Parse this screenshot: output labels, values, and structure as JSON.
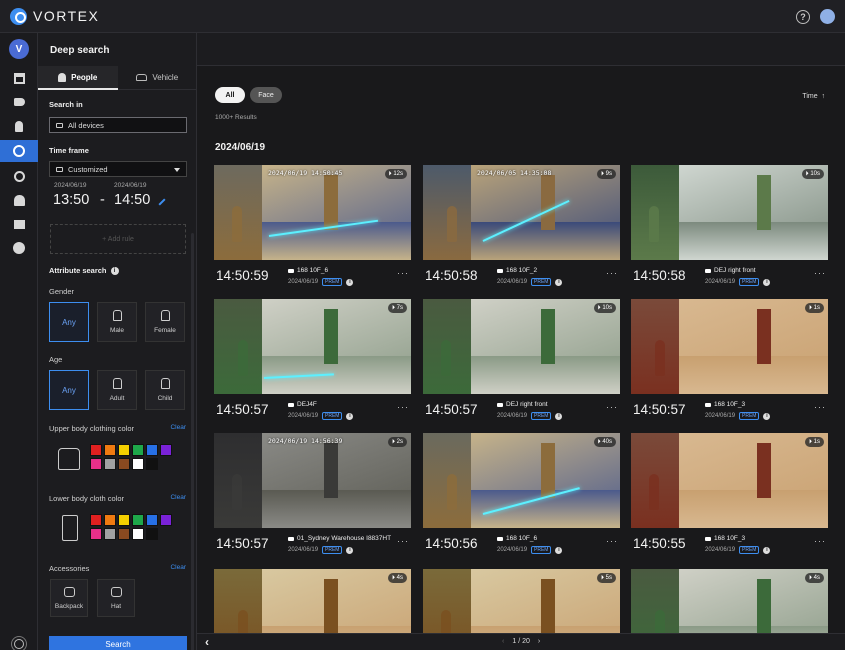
{
  "app": {
    "title": "VORTEX",
    "avatar_letter": "V",
    "accent": "#2f74e0"
  },
  "page_title": "Deep search",
  "tabs": [
    {
      "label": "People",
      "icon": "person-icon",
      "active": true
    },
    {
      "label": "Vehicle",
      "icon": "car-icon",
      "active": false
    }
  ],
  "search_in": {
    "label": "Search in",
    "value": "All devices"
  },
  "time_frame": {
    "label": "Time frame",
    "selected": "Customized",
    "start_date": "2024/06/19",
    "end_date": "2024/06/19",
    "start_time": "13:50",
    "separator": "-",
    "end_time": "14:50"
  },
  "add_rule": "+ Add rule",
  "attribute_search": {
    "label": "Attribute search",
    "gender": {
      "label": "Gender",
      "options": [
        "Any",
        "Male",
        "Female"
      ],
      "selected": "Any"
    },
    "age": {
      "label": "Age",
      "options": [
        "Any",
        "Adult",
        "Child"
      ],
      "selected": "Any"
    },
    "upper_color": {
      "label": "Upper body clothing color",
      "clear": "Clear"
    },
    "lower_color": {
      "label": "Lower body cloth color",
      "clear": "Clear"
    },
    "accessories": {
      "label": "Accessories",
      "clear": "Clear",
      "options": [
        "Backpack",
        "Hat"
      ]
    },
    "swatch_colors": [
      "#e02020",
      "#f07a10",
      "#f5d000",
      "#1ea84a",
      "#2770e6",
      "#7a22d8",
      "#e8308a",
      "#a0a0a0",
      "#8a4a20",
      "#ffffff",
      "#111111"
    ]
  },
  "search_button": "Search",
  "filters": {
    "chips": [
      "All",
      "Face"
    ],
    "sort_label": "Time",
    "sort_arrow": "↑"
  },
  "results_count": "1000+ Results",
  "group_date": "2024/06/19",
  "results": [
    {
      "time": "14:50:59",
      "camera": "168 10F_6",
      "date": "2024/06/19",
      "badge": "PREM",
      "overlay": "2024/06/19 14:50:45",
      "duration": "12s"
    },
    {
      "time": "14:50:58",
      "camera": "168 10F_2",
      "date": "2024/06/19",
      "badge": "PREM",
      "overlay": "2024/06/05 14:35:08",
      "duration": "9s"
    },
    {
      "time": "14:50:58",
      "camera": "DEJ right front",
      "date": "2024/06/19",
      "badge": "PREM",
      "overlay": "",
      "duration": "10s"
    },
    {
      "time": "14:50:57",
      "camera": "DEJ4F",
      "date": "2024/06/19",
      "badge": "PREM",
      "overlay": "",
      "duration": "7s"
    },
    {
      "time": "14:50:57",
      "camera": "DEJ right front",
      "date": "2024/06/19",
      "badge": "PREM",
      "overlay": "",
      "duration": "10s"
    },
    {
      "time": "14:50:57",
      "camera": "168 10F_3",
      "date": "2024/06/19",
      "badge": "PREM",
      "overlay": "",
      "duration": "1s"
    },
    {
      "time": "14:50:57",
      "camera": "01_Sydney Warehouse I8837HT",
      "date": "2024/06/19",
      "badge": "PREM",
      "overlay": "2024/06/19 14:56:39",
      "duration": "2s"
    },
    {
      "time": "14:50:56",
      "camera": "168 10F_6",
      "date": "2024/06/19",
      "badge": "PREM",
      "overlay": "",
      "duration": "40s"
    },
    {
      "time": "14:50:55",
      "camera": "168 10F_3",
      "date": "2024/06/19",
      "badge": "PREM",
      "overlay": "",
      "duration": "1s"
    },
    {
      "time": "",
      "camera": "",
      "date": "",
      "badge": "",
      "overlay": "",
      "duration": "4s"
    },
    {
      "time": "",
      "camera": "",
      "date": "",
      "badge": "",
      "overlay": "",
      "duration": "5s"
    },
    {
      "time": "",
      "camera": "",
      "date": "",
      "badge": "",
      "overlay": "",
      "duration": "4s"
    }
  ],
  "pagination": {
    "prev": "‹",
    "page": "1",
    "separator": "/",
    "total": "20",
    "next": "›"
  },
  "back_label": "‹"
}
